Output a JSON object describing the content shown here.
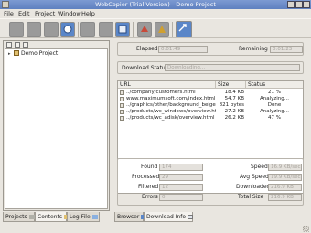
{
  "window": {
    "title": "WebCopier (Trial Version) - Demo Project"
  },
  "menu": [
    "File",
    "Edit",
    "Project",
    "Window",
    "Help"
  ],
  "toolbar": {
    "buttons": [
      "new-project-icon",
      "open-icon",
      "save-icon",
      "properties-icon",
      "start-icon",
      "stop-icon",
      "pause-icon",
      "resume-icon",
      "schedule-icon",
      "browse-icon"
    ]
  },
  "project_tree": {
    "items": [
      {
        "label": "Demo Project"
      }
    ]
  },
  "left_tabs": [
    {
      "label": "Projects",
      "active": false
    },
    {
      "label": "Contents",
      "active": true
    },
    {
      "label": "Log File",
      "active": false
    }
  ],
  "download": {
    "elapsed_label": "Elapsed",
    "elapsed_value": "0:01:49",
    "remaining_label": "Remaining",
    "remaining_value": "0:01:23",
    "status_label": "Download Status",
    "status_value": "Downloading..."
  },
  "table": {
    "columns": [
      "URL",
      "Size",
      "Status"
    ],
    "rows": [
      {
        "url": "../company/customers.html",
        "size": "18.4 KB",
        "status": "21 %"
      },
      {
        "url": "www.maximumsoft.com/index.html",
        "size": "54.7 KB",
        "status": "Analyzing..."
      },
      {
        "url": "../graphics/other/background_beige.gif",
        "size": "821 bytes",
        "status": "Done"
      },
      {
        "url": "../products/wc_windows/overview.html",
        "size": "27.2 KB",
        "status": "Analyzing..."
      },
      {
        "url": "../products/wc_adisk/overview.html",
        "size": "26.2 KB",
        "status": "47 %"
      }
    ]
  },
  "stats": {
    "found_label": "Found",
    "found_value": "174",
    "processed_label": "Processed",
    "processed_value": "29",
    "filtered_label": "Filtered",
    "filtered_value": "12",
    "errors_label": "Errors",
    "errors_value": "0",
    "speed_label": "Speed",
    "speed_value": "16.9 KB/sec",
    "avg_speed_label": "Avg Speed",
    "avg_speed_value": "19.9 KB/sec",
    "downloaded_label": "Downloaded",
    "downloaded_value": "216.9 KB",
    "total_size_label": "Total Size",
    "total_size_value": "216.9 KB"
  },
  "right_tabs": [
    {
      "label": "Browser",
      "active": false
    },
    {
      "label": "Download Info",
      "active": true
    }
  ]
}
